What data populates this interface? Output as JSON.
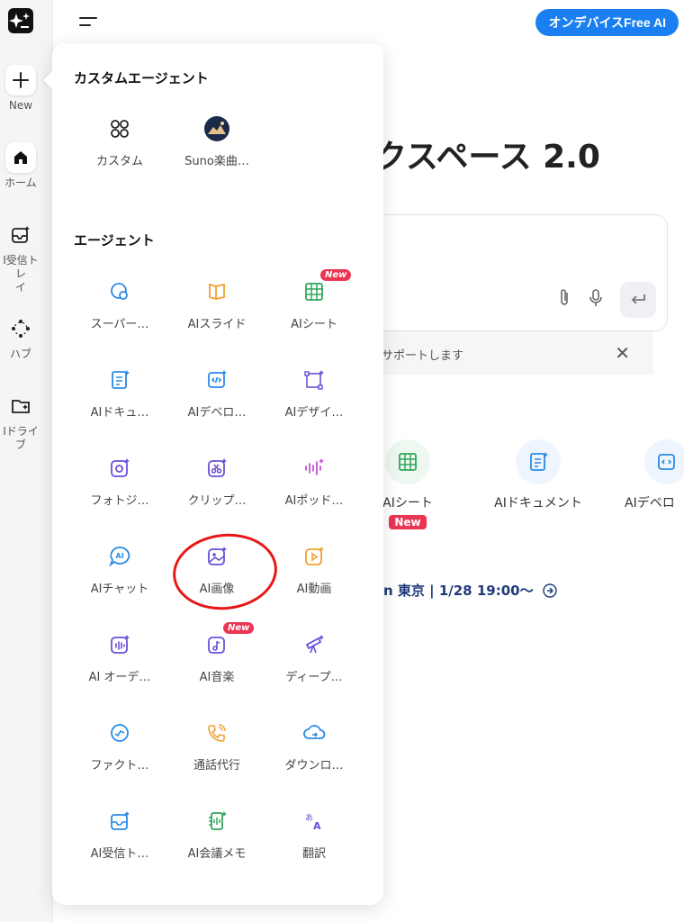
{
  "rail": {
    "items": [
      {
        "label": "New",
        "icon": "plus-icon"
      },
      {
        "label": "ホーム",
        "icon": "home-icon"
      },
      {
        "label": "I受信トレ\nイ",
        "icon": "inbox-icon"
      },
      {
        "label": "ハブ",
        "icon": "hub-icon"
      },
      {
        "label": "Iドライブ",
        "icon": "drive-icon"
      }
    ]
  },
  "header": {
    "cta_label": "オンデバイスFree AI"
  },
  "main": {
    "title": "ークスペース 2.0",
    "notice_text": "サポートします",
    "quick": [
      {
        "label": "AIシート",
        "badge": "New"
      },
      {
        "label": "AIドキュメント"
      },
      {
        "label": "AIデベロ"
      }
    ],
    "event_text": "n 東京 | 1/28 19:00〜"
  },
  "panel": {
    "custom_title": "カスタムエージェント",
    "custom_items": [
      {
        "label": "カスタム",
        "icon": "four-circles-icon"
      },
      {
        "label": "Suno楽曲…",
        "icon": "suno-avatar-icon"
      }
    ],
    "agents_title": "エージェント",
    "agents": [
      {
        "label": "スーパー…",
        "icon": "super-agent-icon",
        "color": "#2a8ae6"
      },
      {
        "label": "AIスライド",
        "icon": "slides-icon",
        "color": "#f0a030"
      },
      {
        "label": "AIシート",
        "icon": "sheet-icon",
        "color": "#2fa55a",
        "badge": "New"
      },
      {
        "label": "AIドキュ…",
        "icon": "document-icon",
        "color": "#2a8ae6"
      },
      {
        "label": "AIデベロ…",
        "icon": "developer-icon",
        "color": "#2a8ae6"
      },
      {
        "label": "AIデザイ…",
        "icon": "design-icon",
        "color": "#6b4ed8"
      },
      {
        "label": "フォトジ…",
        "icon": "photo-icon",
        "color": "#6b4ed8"
      },
      {
        "label": "クリップ…",
        "icon": "clip-icon",
        "color": "#6b4ed8"
      },
      {
        "label": "AIポッド…",
        "icon": "podcast-icon",
        "color": "#c84fd8"
      },
      {
        "label": "AIチャット",
        "icon": "chat-icon",
        "color": "#2a8ae6"
      },
      {
        "label": "AI画像",
        "icon": "image-icon",
        "color": "#6b4ed8"
      },
      {
        "label": "AI動画",
        "icon": "video-icon",
        "color": "#f0a030"
      },
      {
        "label": "AI オーデ…",
        "icon": "audio-icon",
        "color": "#6b4ed8"
      },
      {
        "label": "AI音楽",
        "icon": "music-icon",
        "color": "#6b4ed8",
        "badge": "New"
      },
      {
        "label": "ディープ…",
        "icon": "telescope-icon",
        "color": "#6b4ed8"
      },
      {
        "label": "ファクト…",
        "icon": "fact-check-icon",
        "color": "#2a8ae6"
      },
      {
        "label": "通話代行",
        "icon": "phone-icon",
        "color": "#f0a030"
      },
      {
        "label": "ダウンロ…",
        "icon": "cloud-download-icon",
        "color": "#2a8ae6"
      },
      {
        "label": "AI受信ト…",
        "icon": "inbox-icon",
        "color": "#2a8ae6"
      },
      {
        "label": "AI会議メモ",
        "icon": "meeting-notes-icon",
        "color": "#2fa55a"
      },
      {
        "label": "翻訳",
        "icon": "translate-icon",
        "color": "#6b4ed8"
      }
    ]
  }
}
